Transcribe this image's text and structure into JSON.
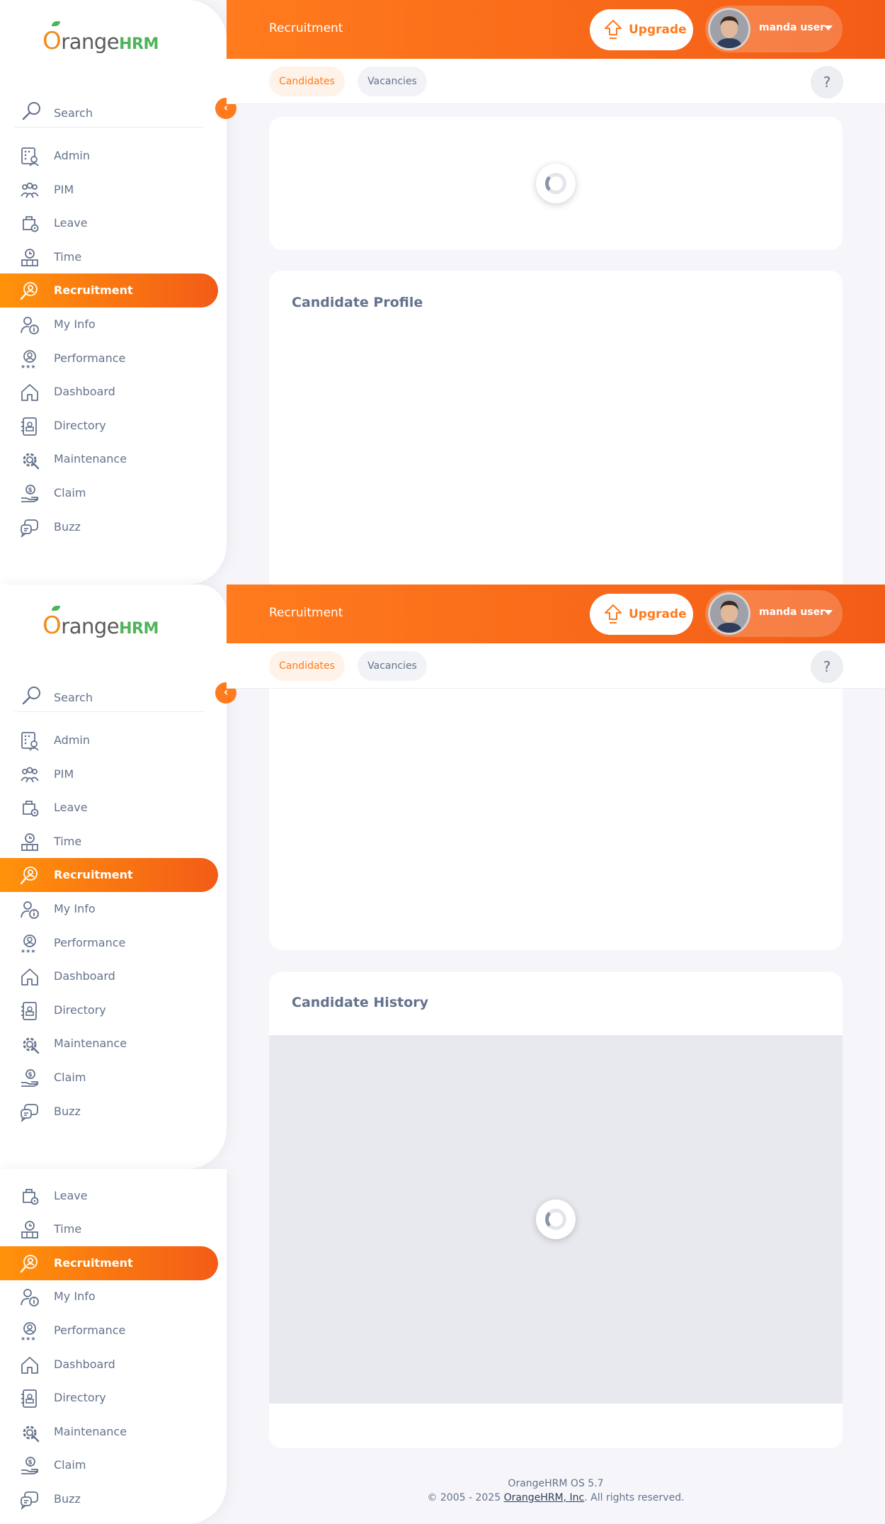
{
  "brand": {
    "logo_word": "range",
    "logo_o": "O",
    "logo_suffix": "HRM"
  },
  "sidebar": {
    "search_placeholder": "Search",
    "collapse_icon": "chevron-left-icon",
    "items": [
      {
        "label": "Admin",
        "icon": "admin-icon"
      },
      {
        "label": "PIM",
        "icon": "pim-icon"
      },
      {
        "label": "Leave",
        "icon": "leave-icon"
      },
      {
        "label": "Time",
        "icon": "time-icon"
      },
      {
        "label": "Recruitment",
        "icon": "recruitment-icon",
        "active": true
      },
      {
        "label": "My Info",
        "icon": "my-info-icon"
      },
      {
        "label": "Performance",
        "icon": "performance-icon"
      },
      {
        "label": "Dashboard",
        "icon": "dashboard-icon"
      },
      {
        "label": "Directory",
        "icon": "directory-icon"
      },
      {
        "label": "Maintenance",
        "icon": "maintenance-icon"
      },
      {
        "label": "Claim",
        "icon": "claim-icon"
      },
      {
        "label": "Buzz",
        "icon": "buzz-icon"
      }
    ]
  },
  "header": {
    "title": "Recruitment",
    "upgrade_label": "Upgrade",
    "user_name": "manda user"
  },
  "tabs": {
    "candidates": "Candidates",
    "vacancies": "Vacancies",
    "help": "?"
  },
  "cards": {
    "profile_title": "Candidate Profile",
    "history_title": "Candidate History"
  },
  "footer": {
    "version": "OrangeHRM OS 5.7",
    "copyright_prefix": "© 2005 - 2025 ",
    "company_link": "OrangeHRM, Inc",
    "copyright_suffix": ". All rights reserved."
  },
  "colors": {
    "accent": "#ff7b1d",
    "accent_dark": "#f35c17",
    "brand_green": "#4fb35a",
    "text": "#64728c"
  }
}
